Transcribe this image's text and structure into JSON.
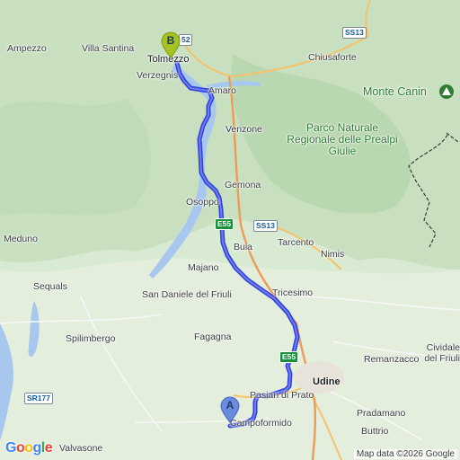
{
  "route": {
    "color": "#4a5af0",
    "start_label": "A",
    "end_label": "B"
  },
  "places": {
    "ampezzo": "Ampezzo",
    "villa_santina": "Villa Santina",
    "tolmezzo": "Tolmezzo",
    "verzegnis": "Verzegnis",
    "chiusaforte": "Chiusaforte",
    "amaro": "Amaro",
    "monte_canin": "Monte Canin",
    "park": "Parco Naturale Regionale delle Prealpi Giulie",
    "venzone": "Venzone",
    "gemona": "Gemona",
    "osoppo": "Osoppo",
    "meduno": "Meduno",
    "buia": "Buia",
    "tarcento": "Tarcento",
    "nimis": "Nimis",
    "majano": "Majano",
    "sequals": "Sequals",
    "san_daniele": "San Daniele del Friuli",
    "tricesimo": "Tricesimo",
    "spilimbergo": "Spilimbergo",
    "fagagna": "Fagagna",
    "cividale": "Cividale del Friuli",
    "remanzacco": "Remanzacco",
    "udine": "Udine",
    "pasian": "Pasian di Prato",
    "pradamano": "Pradamano",
    "campoformido": "Campoformido",
    "buttrio": "Buttrio",
    "valvasone": "Valvasone"
  },
  "roads": {
    "ss13_top": "SS13",
    "ss52": "52",
    "e55_osoppo": "E55",
    "ss13_mid": "SS13",
    "e55_udine": "E55",
    "sr177": "SR177"
  },
  "branding": {
    "logo": "Google",
    "attribution": "Map data ©2026 Google"
  },
  "colors": {
    "land": "#d9ead3",
    "forest": "#bcd9b4",
    "water": "#a8c7ee",
    "border": "#3c3c3c"
  }
}
